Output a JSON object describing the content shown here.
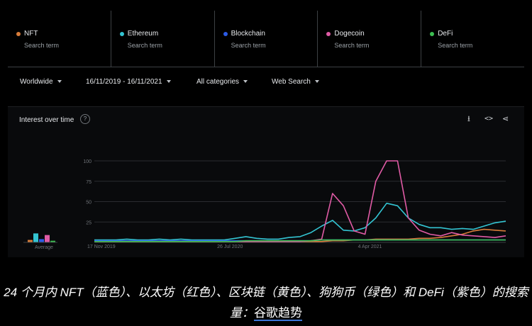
{
  "search_terms": [
    {
      "label": "NFT",
      "sublabel": "Search term",
      "color": "#d87c3a"
    },
    {
      "label": "Ethereum",
      "sublabel": "Search term",
      "color": "#33c4d2"
    },
    {
      "label": "Blockchain",
      "sublabel": "Search term",
      "color": "#2c5be6"
    },
    {
      "label": "Dogecoin",
      "sublabel": "Search term",
      "color": "#e05ba5"
    },
    {
      "label": "DeFi",
      "sublabel": "Search term",
      "color": "#3dbf52"
    }
  ],
  "filters": {
    "region": "Worldwide",
    "date_range": "16/11/2019 - 16/11/2021",
    "category": "All categories",
    "search_type": "Web Search"
  },
  "card": {
    "title": "Interest over time",
    "help_icon": "question-icon",
    "tool_icons": [
      "download-icon",
      "embed-code-icon",
      "share-icon"
    ]
  },
  "caption": {
    "text": "24 个月内 NFT（蓝色）、以太坊（红色）、区块链（黄色）、狗狗币（绿色）和 DeFi（紫色）的搜索量：",
    "link": "谷歌趋势"
  },
  "chart_data": {
    "type": "line",
    "title": "",
    "ylim": [
      0,
      100
    ],
    "yticks": [
      25,
      50,
      75,
      100
    ],
    "x_tick_labels": [
      "17 Nov 2019",
      "26 Jul 2020",
      "4 Apr 2021"
    ],
    "x": [
      "17 Nov 2019",
      "8 Dec 2019",
      "29 Dec 2019",
      "19 Jan 2020",
      "9 Feb 2020",
      "1 Mar 2020",
      "22 Mar 2020",
      "12 Apr 2020",
      "3 May 2020",
      "24 May 2020",
      "14 Jun 2020",
      "5 Jul 2020",
      "26 Jul 2020",
      "16 Aug 2020",
      "6 Sep 2020",
      "27 Sep 2020",
      "18 Oct 2020",
      "8 Nov 2020",
      "29 Nov 2020",
      "20 Dec 2020",
      "10 Jan 2021",
      "31 Jan 2021",
      "14 Feb 2021",
      "28 Feb 2021",
      "14 Mar 2021",
      "4 Apr 2021",
      "25 Apr 2021",
      "9 May 2021",
      "16 May 2021",
      "30 May 2021",
      "20 Jun 2021",
      "11 Jul 2021",
      "1 Aug 2021",
      "22 Aug 2021",
      "12 Sep 2021",
      "3 Oct 2021",
      "24 Oct 2021",
      "7 Nov 2021",
      "14 Nov 2021"
    ],
    "series": [
      {
        "name": "NFT",
        "color": "#d87c3a",
        "values": [
          1,
          1,
          1,
          1,
          1,
          1,
          1,
          1,
          1,
          1,
          1,
          1,
          1,
          1,
          1,
          1,
          1,
          1,
          1,
          1,
          1,
          1,
          2,
          2,
          3,
          3,
          4,
          4,
          4,
          4,
          5,
          5,
          6,
          8,
          10,
          14,
          16,
          15,
          14
        ]
      },
      {
        "name": "Ethereum",
        "color": "#33c4d2",
        "values": [
          3,
          3,
          3,
          4,
          3,
          3,
          4,
          3,
          4,
          3,
          3,
          3,
          3,
          5,
          7,
          5,
          4,
          4,
          6,
          7,
          12,
          20,
          27,
          15,
          14,
          18,
          30,
          48,
          45,
          30,
          22,
          18,
          18,
          16,
          17,
          16,
          20,
          24,
          26
        ]
      },
      {
        "name": "Blockchain",
        "color": "#2c5be6",
        "values": [
          2,
          2,
          2,
          2,
          2,
          2,
          2,
          2,
          2,
          2,
          2,
          2,
          2,
          2,
          2,
          2,
          2,
          2,
          2,
          2,
          2,
          3,
          3,
          3,
          3,
          3,
          3,
          3,
          3,
          3,
          3,
          3,
          3,
          3,
          3,
          3,
          3,
          3,
          3
        ]
      },
      {
        "name": "Dogecoin",
        "color": "#e05ba5",
        "values": [
          1,
          1,
          1,
          1,
          1,
          1,
          1,
          1,
          1,
          1,
          1,
          1,
          1,
          1,
          1,
          1,
          1,
          1,
          1,
          1,
          2,
          4,
          60,
          45,
          14,
          10,
          75,
          100,
          100,
          30,
          15,
          10,
          8,
          12,
          9,
          8,
          7,
          6,
          8
        ]
      },
      {
        "name": "DeFi",
        "color": "#3dbf52",
        "values": [
          1,
          1,
          1,
          1,
          1,
          1,
          1,
          1,
          1,
          1,
          1,
          1,
          1,
          1,
          2,
          2,
          2,
          2,
          2,
          2,
          2,
          3,
          3,
          3,
          3,
          3,
          3,
          3,
          3,
          3,
          3,
          3,
          3,
          3,
          3,
          3,
          3,
          3,
          3
        ]
      }
    ],
    "average": [
      {
        "name": "NFT",
        "color": "#d87c3a",
        "value": 3
      },
      {
        "name": "Ethereum",
        "color": "#33c4d2",
        "value": 11
      },
      {
        "name": "Blockchain",
        "color": "#2c5be6",
        "value": 4
      },
      {
        "name": "Dogecoin",
        "color": "#e05ba5",
        "value": 9
      },
      {
        "name": "DeFi",
        "color": "#3dbf52",
        "value": 2
      }
    ],
    "average_label": "Average"
  }
}
